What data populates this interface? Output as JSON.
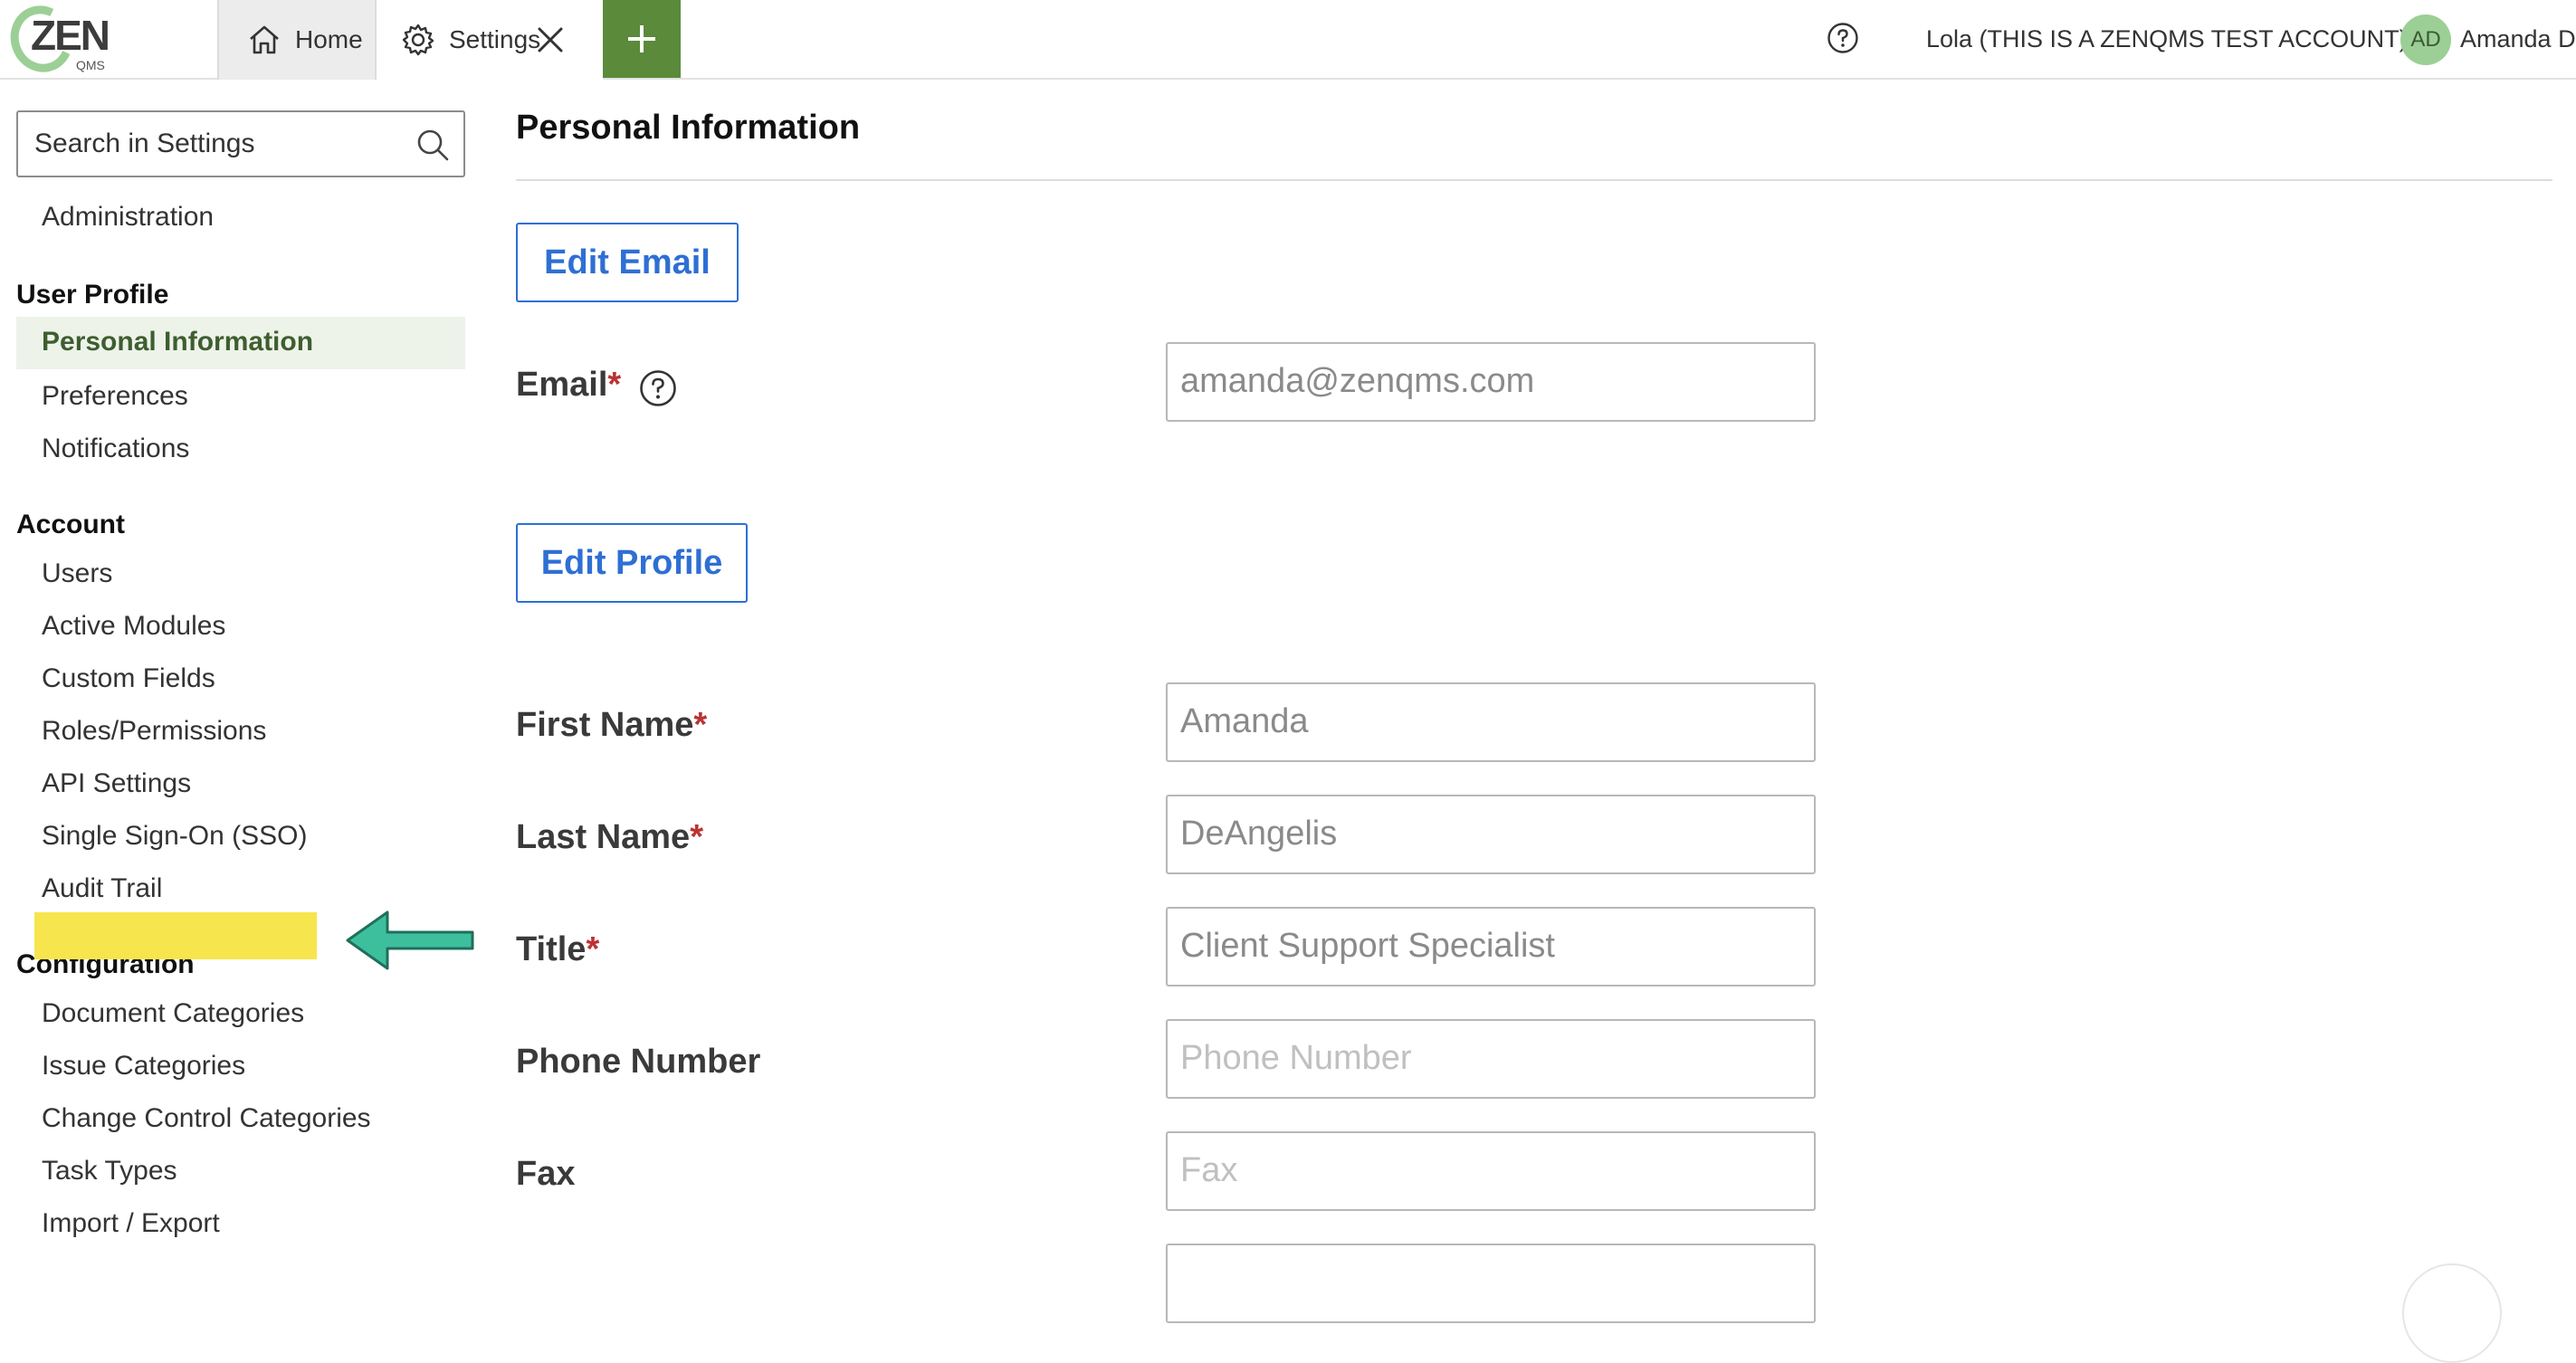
{
  "topbar": {
    "logo_word": "ZEN",
    "logo_sub": "QMS",
    "home_tab": "Home",
    "settings_tab": "Settings",
    "account": "Lola (THIS IS A ZENQMS TEST ACCOUNT)",
    "avatar_initials": "AD",
    "user": "Amanda D"
  },
  "sidebar": {
    "search_placeholder": "Search in Settings",
    "admin": "Administration",
    "user_profile_header": "User Profile",
    "user_profile_items": [
      "Personal Information",
      "Preferences",
      "Notifications"
    ],
    "account_header": "Account",
    "account_items": [
      "Users",
      "Active Modules",
      "Custom Fields",
      "Roles/Permissions",
      "API Settings",
      "Single Sign-On (SSO)",
      "Audit Trail"
    ],
    "configuration_header": "Configuration",
    "configuration_items": [
      "Document Categories",
      "Issue Categories",
      "Change Control Categories",
      "Task Types",
      "Import / Export"
    ]
  },
  "main": {
    "title": "Personal Information",
    "edit_email": "Edit Email",
    "edit_profile": "Edit Profile",
    "required_mark": "*",
    "fields": {
      "email": {
        "label": "Email",
        "value": "amanda@zenqms.com"
      },
      "first_name": {
        "label": "First Name",
        "value": "Amanda"
      },
      "last_name": {
        "label": "Last Name",
        "value": "DeAngelis"
      },
      "title": {
        "label": "Title",
        "value": "Client Support Specialist"
      },
      "phone": {
        "label": "Phone Number",
        "placeholder": "Phone Number"
      },
      "fax": {
        "label": "Fax",
        "placeholder": "Fax"
      }
    }
  },
  "colors": {
    "accent_green": "#5a8a3a",
    "link_blue": "#2e6fd4",
    "highlight_yellow": "#f7e54d",
    "arrow_teal": "#3dbf9d"
  }
}
